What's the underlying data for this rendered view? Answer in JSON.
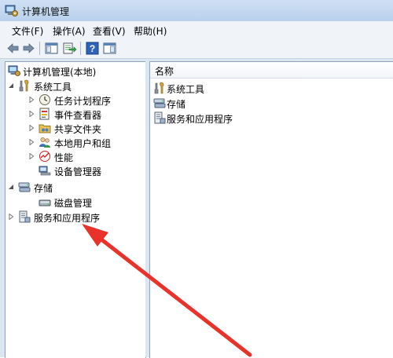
{
  "window": {
    "title": "计算机管理"
  },
  "menu": [
    {
      "label": "文件(F)"
    },
    {
      "label": "操作(A)"
    },
    {
      "label": "查看(V)"
    },
    {
      "label": "帮助(H)"
    }
  ],
  "tree": {
    "root": "计算机管理(本地)",
    "system_tools": "系统工具",
    "task_scheduler": "任务计划程序",
    "event_viewer": "事件查看器",
    "shared_folders": "共享文件夹",
    "local_users": "本地用户和组",
    "performance": "性能",
    "device_manager": "设备管理器",
    "storage": "存储",
    "disk_management": "磁盘管理",
    "services_apps": "服务和应用程序"
  },
  "list": {
    "column_name": "名称",
    "items": [
      "系统工具",
      "存储",
      "服务和应用程序"
    ]
  },
  "colors": {
    "arrow": "#e8332b",
    "selection": "#cce8ff"
  }
}
